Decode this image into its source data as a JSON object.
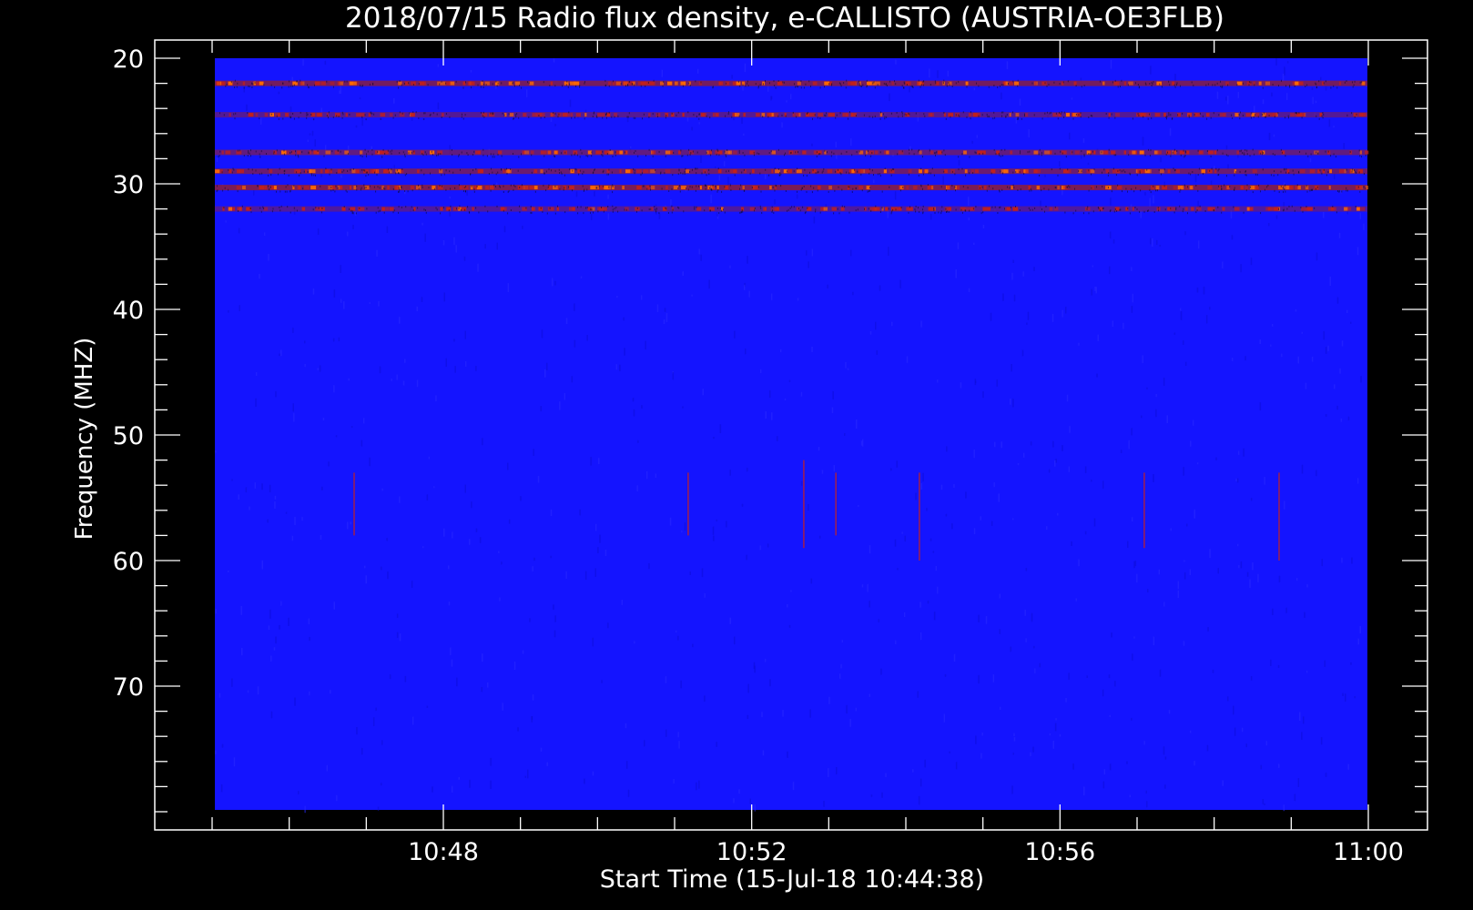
{
  "chart_data": {
    "type": "heatmap",
    "title": "2018/07/15  Radio flux density, e-CALLISTO (AUSTRIA-OE3FLB)",
    "xlabel": "Start Time (15-Jul-18 10:44:38)",
    "ylabel": "Frequency (MHZ)",
    "x_range": [
      "10:45",
      "11:00"
    ],
    "y_range": [
      20,
      80
    ],
    "y_inverted": true,
    "x_ticks": [
      "10:48",
      "10:52",
      "10:56",
      "11:00"
    ],
    "y_ticks": [
      20,
      30,
      40,
      50,
      60,
      70
    ],
    "colormap": [
      "#000000",
      "#1414ff",
      "#c0201c",
      "#ff6a00",
      "#ffd000"
    ],
    "background_color": "#1414ff",
    "rfi_bands_mhz": [
      {
        "freq": 22.0,
        "intensity": 0.85
      },
      {
        "freq": 24.5,
        "intensity": 0.35
      },
      {
        "freq": 27.5,
        "intensity": 0.55
      },
      {
        "freq": 29.0,
        "intensity": 0.7
      },
      {
        "freq": 30.3,
        "intensity": 0.95
      },
      {
        "freq": 32.0,
        "intensity": 0.25
      }
    ],
    "spikes": [
      {
        "time": "10:46:50",
        "f_start": 53,
        "f_end": 58
      },
      {
        "time": "10:51:10",
        "f_start": 53,
        "f_end": 58
      },
      {
        "time": "10:52:40",
        "f_start": 52,
        "f_end": 59
      },
      {
        "time": "10:53:05",
        "f_start": 53,
        "f_end": 58
      },
      {
        "time": "10:54:10",
        "f_start": 53,
        "f_end": 60
      },
      {
        "time": "10:57:05",
        "f_start": 53,
        "f_end": 59
      },
      {
        "time": "10:58:50",
        "f_start": 53,
        "f_end": 60
      }
    ]
  }
}
